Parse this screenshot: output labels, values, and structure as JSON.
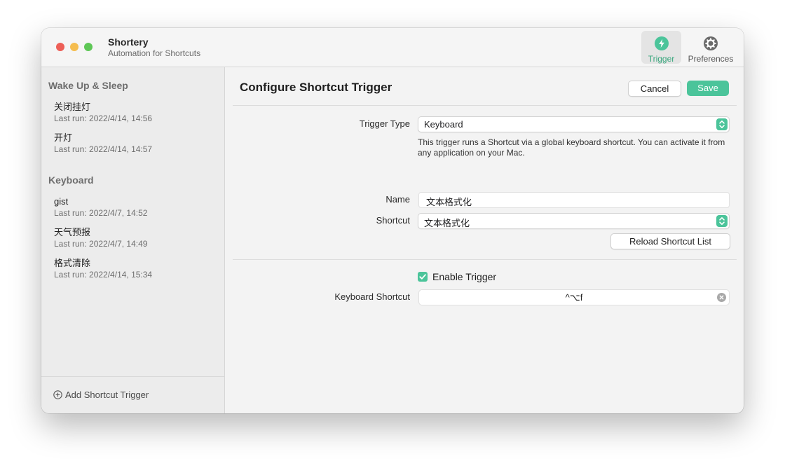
{
  "app": {
    "title": "Shortery",
    "subtitle": "Automation for Shortcuts"
  },
  "toolbar": {
    "trigger_label": "Trigger",
    "preferences_label": "Preferences"
  },
  "sidebar": {
    "sections": [
      {
        "title": "Wake Up & Sleep",
        "items": [
          {
            "name": "关闭挂灯",
            "last_run": "Last run: 2022/4/14, 14:56"
          },
          {
            "name": "开灯",
            "last_run": "Last run: 2022/4/14, 14:57"
          }
        ]
      },
      {
        "title": "Keyboard",
        "items": [
          {
            "name": "gist",
            "last_run": "Last run: 2022/4/7, 14:52"
          },
          {
            "name": "天气预报",
            "last_run": "Last run: 2022/4/7, 14:49"
          },
          {
            "name": "格式清除",
            "last_run": "Last run: 2022/4/14, 15:34"
          }
        ]
      }
    ],
    "add_label": "Add Shortcut Trigger"
  },
  "main": {
    "title": "Configure Shortcut Trigger",
    "cancel_label": "Cancel",
    "save_label": "Save",
    "trigger_type_label": "Trigger Type",
    "trigger_type_value": "Keyboard",
    "help_text": "This trigger runs a Shortcut via a global keyboard shortcut. You can activate it from any application on your Mac.",
    "name_label": "Name",
    "name_value": "文本格式化",
    "shortcut_label": "Shortcut",
    "shortcut_value": "文本格式化",
    "reload_label": "Reload Shortcut List",
    "enable_label": "Enable Trigger",
    "enable_checked": true,
    "keyboard_shortcut_label": "Keyboard Shortcut",
    "keyboard_shortcut_value": "^⌥f"
  },
  "colors": {
    "accent": "#4bc49a",
    "close": "#ed5f57",
    "minimize": "#f5bd4f",
    "maximize": "#5ec756"
  },
  "icons": {
    "trigger": "bolt-icon",
    "preferences": "gear-icon",
    "add": "plus-circle-icon",
    "popup": "chevron-updown-icon",
    "clear": "clear-x-icon",
    "check": "checkmark-icon"
  }
}
